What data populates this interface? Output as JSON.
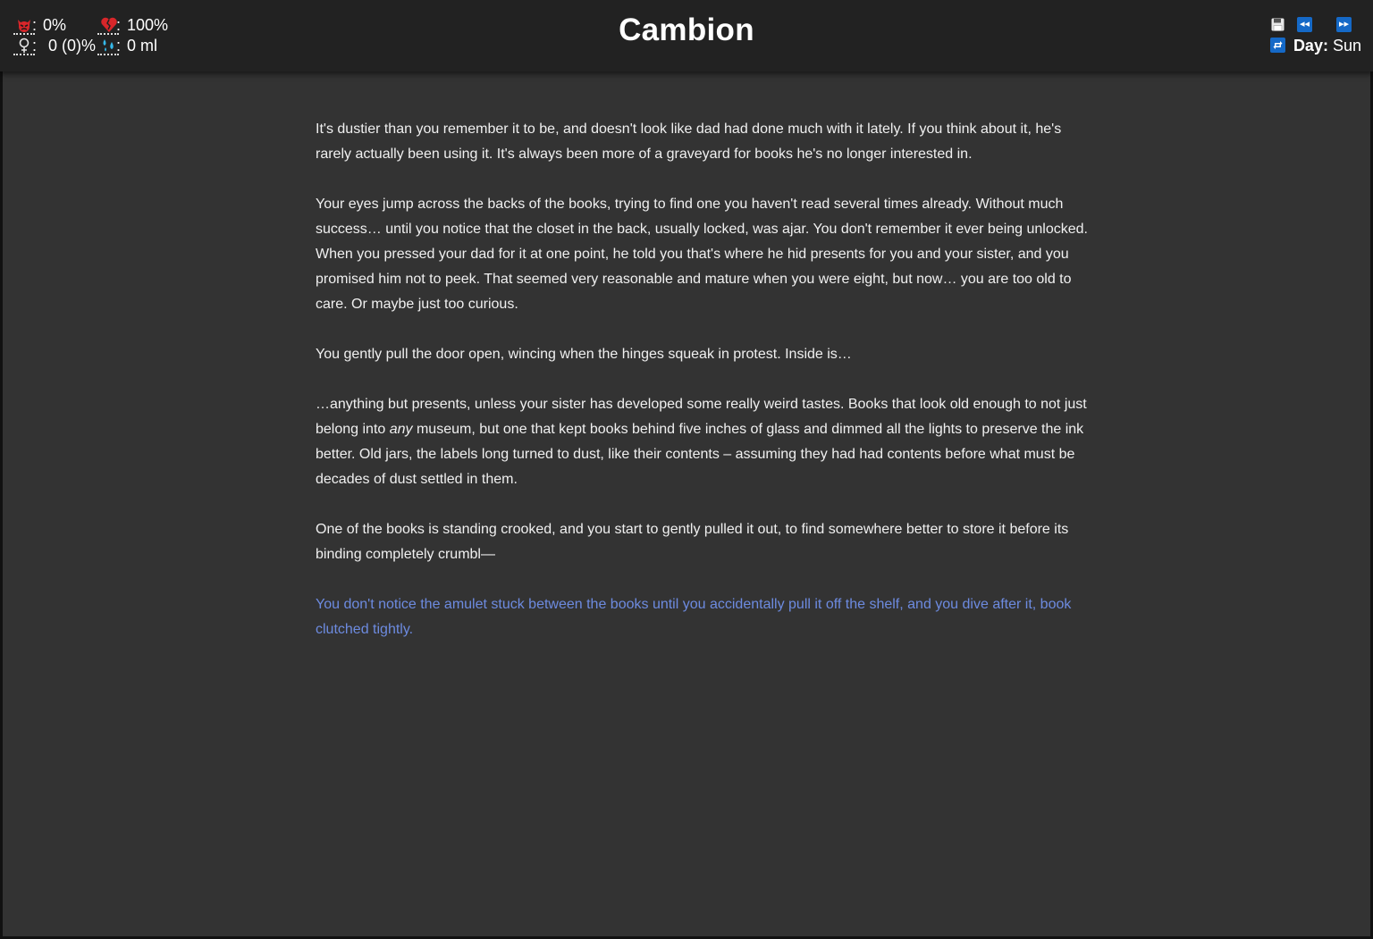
{
  "header": {
    "title": "Cambion",
    "stats": [
      {
        "icon": "demon-face-icon",
        "value": "0%"
      },
      {
        "icon": "broken-heart-icon",
        "value": "100%"
      },
      {
        "icon": "female-symbol-icon",
        "value": "0 (0)%"
      },
      {
        "icon": "fluid-drops-icon",
        "value": "0 ml"
      }
    ],
    "stat_separator": ":",
    "toolbar": {
      "save_icon": "save-icon",
      "rewind_icon": "rewind-icon",
      "forward_icon": "fast-forward-icon",
      "restart_icon": "restart-icon"
    },
    "day_label": "Day:",
    "day_value": "Sun"
  },
  "story": {
    "paragraphs": [
      "It's dustier than you remember it to be, and doesn't look like dad had done much with it lately. If you think about it, he's rarely actually been using it. It's always been more of a graveyard for books he's no longer interested in.",
      "Your eyes jump across the backs of the books, trying to find one you haven't read several times already. Without much success… until you notice that the closet in the back, usually locked, was ajar. You don't remember it ever being unlocked. When you pressed your dad for it at one point, he told you that's where he hid presents for you and your sister, and you promised him not to peek. That seemed very reasonable and mature when you were eight, but now… you are too old to care. Or maybe just too curious.",
      "You gently pull the door open, wincing when the hinges squeak in protest. Inside is…"
    ],
    "p4_before": "…anything but presents, unless your sister has developed some really weird tastes. Books that look old enough to not just belong into ",
    "p4_italic": "any",
    "p4_after": " museum, but one that kept books behind five inches of glass and dimmed all the lights to preserve the ink better. Old jars, the labels long turned to dust, like their contents – assuming they had had contents before what must be decades of dust settled in them.",
    "p5": "One of the books is standing crooked, and you start to gently pulled it out, to find somewhere better to store it before its binding completely crumbl—",
    "link_text": "You don't notice the amulet stuck between the books until you accidentally pull it off the shelf, and you dive after it, book clutched tightly.",
    "link_color": "#6d8be0"
  },
  "colors": {
    "background": "#333333",
    "header": "#222222",
    "button": "#1569c7",
    "text": "#f0f0f0"
  }
}
